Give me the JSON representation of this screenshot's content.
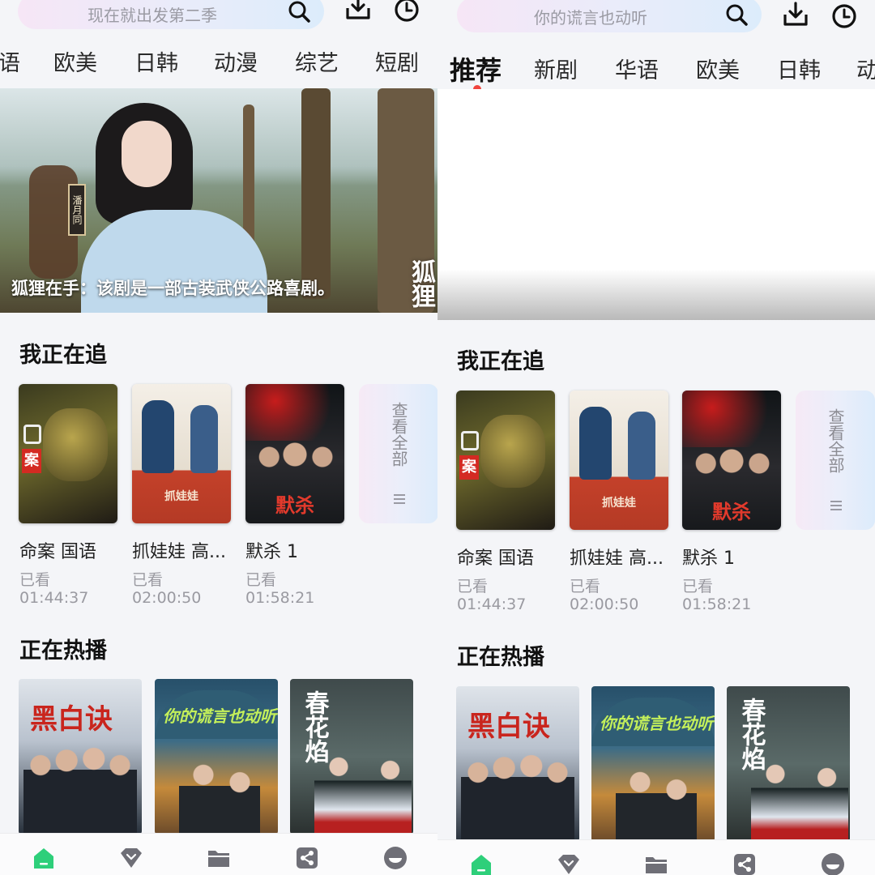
{
  "left": {
    "search": {
      "placeholder": "现在就出发第二季"
    },
    "tabs": [
      "语",
      "欧美",
      "日韩",
      "动漫",
      "综艺",
      "短剧"
    ],
    "banner": {
      "caption": "狐狸在手：该剧是一部古装武侠公路喜剧。"
    },
    "following": {
      "title": "我正在追",
      "view_all": "查看全部",
      "items": [
        {
          "title": "命案 国语",
          "status": "已看",
          "time": "01:44:37"
        },
        {
          "title": "抓娃娃 高...",
          "status": "已看",
          "time": "02:00:50"
        },
        {
          "title": "默杀 1",
          "status": "已看",
          "time": "01:58:21"
        }
      ]
    },
    "hot": {
      "title": "正在热播"
    }
  },
  "right": {
    "search": {
      "placeholder": "你的谎言也动听"
    },
    "tabs": [
      "推荐",
      "新剧",
      "华语",
      "欧美",
      "日韩",
      "动"
    ],
    "following": {
      "title": "我正在追",
      "view_all": "查看全部",
      "items": [
        {
          "title": "命案 国语",
          "status": "已看",
          "time": "01:44:37"
        },
        {
          "title": "抓娃娃 高...",
          "status": "已看",
          "time": "02:00:50"
        },
        {
          "title": "默杀 1",
          "status": "已看",
          "time": "01:58:21"
        }
      ]
    },
    "hot": {
      "title": "正在热播"
    }
  },
  "colors": {
    "accent_green": "#2ecf7a",
    "tab_dot": "#f0433d",
    "icon_gray": "#9a9aa3"
  },
  "icons": [
    "search-icon",
    "download-icon",
    "history-icon",
    "home-icon",
    "diamond-icon",
    "folder-icon",
    "share-icon",
    "profile-icon",
    "list-icon"
  ]
}
